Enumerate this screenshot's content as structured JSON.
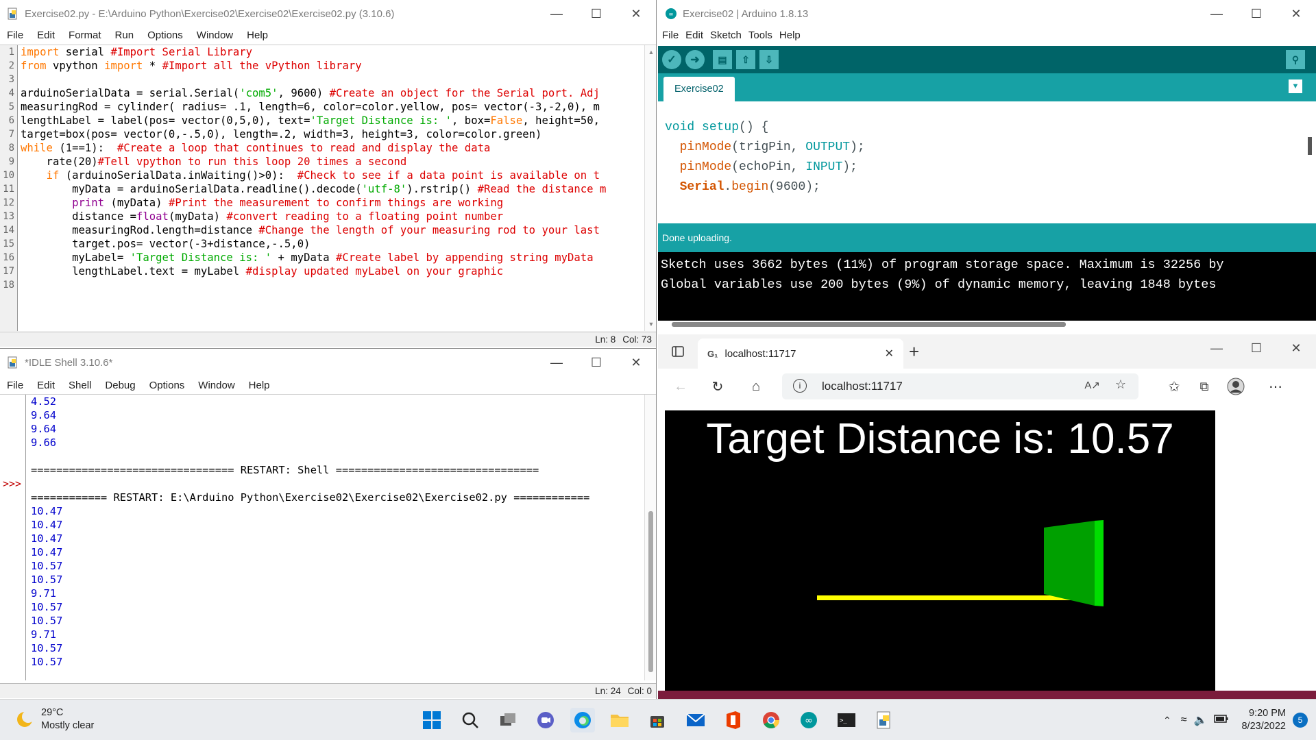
{
  "idle_editor": {
    "title": "Exercise02.py - E:\\Arduino Python\\Exercise02\\Exercise02\\Exercise02.py (3.10.6)",
    "menu": [
      "File",
      "Edit",
      "Format",
      "Run",
      "Options",
      "Window",
      "Help"
    ],
    "line_numbers": [
      "1",
      "2",
      "3",
      "4",
      "5",
      "6",
      "7",
      "8",
      "9",
      "10",
      "11",
      "12",
      "13",
      "14",
      "15",
      "16",
      "17",
      "18"
    ],
    "code": [
      [
        {
          "t": "import",
          "c": "kw"
        },
        {
          "t": " serial "
        },
        {
          "t": "#Import Serial Library",
          "c": "cm"
        }
      ],
      [
        {
          "t": "from",
          "c": "kw"
        },
        {
          "t": " vpython "
        },
        {
          "t": "import",
          "c": "kw"
        },
        {
          "t": " * "
        },
        {
          "t": "#Import all the vPython library",
          "c": "cm"
        }
      ],
      [],
      [
        {
          "t": "arduinoSerialData = serial.Serial("
        },
        {
          "t": "'com5'",
          "c": "st"
        },
        {
          "t": ", 9600) "
        },
        {
          "t": "#Create an object for the Serial port. Adj",
          "c": "cm"
        }
      ],
      [
        {
          "t": "measuringRod = cylinder( radius= .1, length=6, color=color.yellow, pos= vector(-3,-2,0), m"
        }
      ],
      [
        {
          "t": "lengthLabel = label(pos= vector(0,5,0), text="
        },
        {
          "t": "'Target Distance is: '",
          "c": "st"
        },
        {
          "t": ", box="
        },
        {
          "t": "False",
          "c": "kw"
        },
        {
          "t": ", height=50,"
        }
      ],
      [
        {
          "t": "target=box(pos= vector(0,-.5,0), length=.2, width=3, height=3, color=color.green)"
        }
      ],
      [
        {
          "t": "while",
          "c": "kw"
        },
        {
          "t": " (1==1):  "
        },
        {
          "t": "#Create a loop that continues to read and display the data",
          "c": "cm"
        }
      ],
      [
        {
          "t": "    rate(20)"
        },
        {
          "t": "#Tell vpython to run this loop 20 times a second",
          "c": "cm"
        }
      ],
      [
        {
          "t": "    "
        },
        {
          "t": "if",
          "c": "kw"
        },
        {
          "t": " (arduinoSerialData.inWaiting()>0):  "
        },
        {
          "t": "#Check to see if a data point is available on t",
          "c": "cm"
        }
      ],
      [
        {
          "t": "        myData = arduinoSerialData.readline().decode("
        },
        {
          "t": "'utf-8'",
          "c": "st"
        },
        {
          "t": ").rstrip() "
        },
        {
          "t": "#Read the distance m",
          "c": "cm"
        }
      ],
      [
        {
          "t": "        "
        },
        {
          "t": "print",
          "c": "bi"
        },
        {
          "t": " (myData) "
        },
        {
          "t": "#Print the measurement to confirm things are working",
          "c": "cm"
        }
      ],
      [
        {
          "t": "        distance ="
        },
        {
          "t": "float",
          "c": "bi"
        },
        {
          "t": "(myData) "
        },
        {
          "t": "#convert reading to a floating point number",
          "c": "cm"
        }
      ],
      [
        {
          "t": "        measuringRod.length=distance "
        },
        {
          "t": "#Change the length of your measuring rod to your last",
          "c": "cm"
        }
      ],
      [
        {
          "t": "        target.pos= vector(-3+distance,-.5,0)"
        }
      ],
      [
        {
          "t": "        myLabel= "
        },
        {
          "t": "'Target Distance is: '",
          "c": "st"
        },
        {
          "t": " + myData "
        },
        {
          "t": "#Create label by appending string myData",
          "c": "cm"
        }
      ],
      [
        {
          "t": "        lengthLabel.text = myLabel "
        },
        {
          "t": "#display updated myLabel on your graphic",
          "c": "cm"
        }
      ],
      []
    ],
    "status_ln": "Ln: 8",
    "status_col": "Col: 73"
  },
  "idle_shell": {
    "title": "*IDLE Shell 3.10.6*",
    "menu": [
      "File",
      "Edit",
      "Shell",
      "Debug",
      "Options",
      "Window",
      "Help"
    ],
    "prompt": ">>>",
    "lines": [
      {
        "t": "4.52"
      },
      {
        "t": "9.64"
      },
      {
        "t": "9.64"
      },
      {
        "t": "9.66"
      },
      {
        "t": ""
      },
      {
        "t": "================================ RESTART: Shell ================================",
        "rs": true
      },
      {
        "t": ""
      },
      {
        "t": "============ RESTART: E:\\Arduino Python\\Exercise02\\Exercise02\\Exercise02.py ============",
        "rs": true
      },
      {
        "t": "10.47"
      },
      {
        "t": "10.47"
      },
      {
        "t": "10.47"
      },
      {
        "t": "10.47"
      },
      {
        "t": "10.57"
      },
      {
        "t": "10.57"
      },
      {
        "t": "9.71"
      },
      {
        "t": "10.57"
      },
      {
        "t": "10.57"
      },
      {
        "t": "9.71"
      },
      {
        "t": "10.57"
      },
      {
        "t": "10.57"
      }
    ],
    "status_ln": "Ln: 24",
    "status_col": "Col: 0"
  },
  "arduino": {
    "title": "Exercise02 | Arduino 1.8.13",
    "menu": [
      "File",
      "Edit",
      "Sketch",
      "Tools",
      "Help"
    ],
    "tab": "Exercise02",
    "code": [
      [
        {
          "t": "void",
          "c": "a-kw"
        },
        {
          "t": " "
        },
        {
          "t": "setup",
          "c": "a-kw"
        },
        {
          "t": "() {"
        }
      ],
      [
        {
          "t": "  "
        },
        {
          "t": "pinMode",
          "c": "a-fn"
        },
        {
          "t": "(trigPin, "
        },
        {
          "t": "OUTPUT",
          "c": "a-cn"
        },
        {
          "t": ");"
        }
      ],
      [
        {
          "t": "  "
        },
        {
          "t": "pinMode",
          "c": "a-fn"
        },
        {
          "t": "(echoPin, "
        },
        {
          "t": "INPUT",
          "c": "a-cn"
        },
        {
          "t": ");"
        }
      ],
      [
        {
          "t": "  "
        },
        {
          "t": "Serial",
          "c": "a-ser"
        },
        {
          "t": "."
        },
        {
          "t": "begin",
          "c": "a-fn"
        },
        {
          "t": "(9600);"
        }
      ]
    ],
    "status": "Done uploading.",
    "console": [
      "Sketch uses 3662 bytes (11%) of program storage space. Maximum is 32256 by",
      "Global variables use 200 bytes (9%) of dynamic memory, leaving 1848 bytes"
    ]
  },
  "browser": {
    "tab_title": "localhost:11717",
    "url": "localhost:11717",
    "canvas_label": "Target Distance is: 10.57",
    "colors": {
      "rod": "#ffff00",
      "target": "#00cc00",
      "canvas": "#000000"
    }
  },
  "taskbar": {
    "temperature": "29°C",
    "weather": "Mostly clear",
    "time": "9:20 PM",
    "date": "8/23/2022",
    "notifications": "5",
    "apps": [
      "start-icon",
      "search-icon",
      "task-view-icon",
      "chat-icon",
      "edge-icon",
      "file-explorer-icon",
      "store-icon",
      "mail-icon",
      "office-icon",
      "chrome-icon",
      "arduino-icon",
      "terminal-icon",
      "python-idle-icon"
    ]
  }
}
